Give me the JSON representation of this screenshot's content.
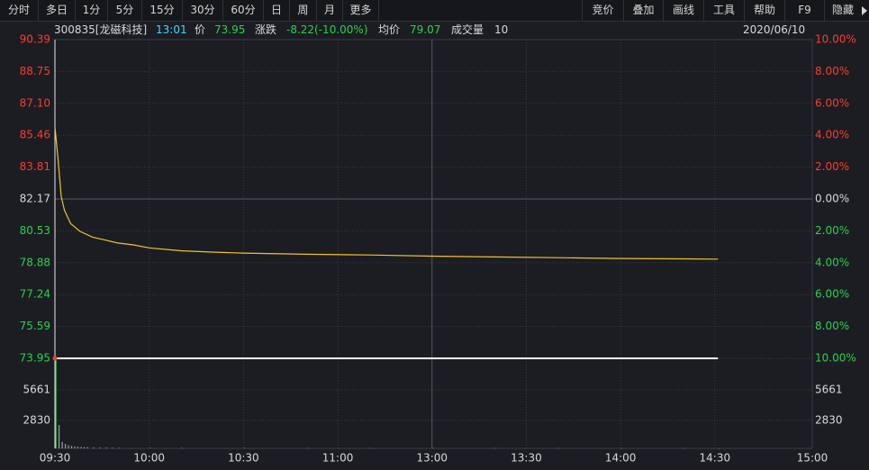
{
  "toolbar": {
    "left_tabs": [
      "分时",
      "多日",
      "1分",
      "5分",
      "15分",
      "30分",
      "60分",
      "日",
      "周",
      "月",
      "更多"
    ],
    "active_tab": "分时",
    "right_tools": [
      "竞价",
      "叠加",
      "画线",
      "工具",
      "帮助",
      "F9",
      "隐藏"
    ]
  },
  "info_bar": {
    "stock": "300835[龙磁科技]",
    "time": "13:01",
    "price_label": "价",
    "price": "73.95",
    "change_label": "涨跌",
    "change": "-8.22(-10.00%)",
    "avg_label": "均价",
    "avg": "79.07",
    "volume_label": "成交量",
    "volume": "10",
    "date": "2020/06/10"
  },
  "colors": {
    "up": "#ff3b30",
    "down": "#2ed04e",
    "neutral": "#d8d8d8",
    "avg_line": "#f0c22e",
    "price_line": "#ffffff",
    "grid": "#3a3d44",
    "grid_bright": "#555963"
  },
  "chart_data": {
    "type": "line",
    "symbol": "300835",
    "prev_close": 82.17,
    "price_axis_left": [
      "90.39",
      "88.75",
      "87.10",
      "85.46",
      "83.81",
      "82.17",
      "80.53",
      "78.88",
      "77.24",
      "75.59",
      "73.95"
    ],
    "percent_axis_right": [
      "10.00%",
      "8.00%",
      "6.00%",
      "4.00%",
      "2.00%",
      "0.00%",
      "2.00%",
      "4.00%",
      "6.00%",
      "8.00%",
      "10.00%"
    ],
    "ylim": [
      73.95,
      90.39
    ],
    "volume_axis": [
      "5661",
      "2830"
    ],
    "volume_max": 8491,
    "x_ticks": [
      "09:30",
      "10:00",
      "10:30",
      "11:00",
      "13:00",
      "13:30",
      "14:00",
      "14:30",
      "15:00"
    ],
    "series": [
      {
        "name": "price",
        "minutes": [
          0,
          1,
          211
        ],
        "values": [
          73.95,
          73.95,
          73.95
        ]
      },
      {
        "name": "avg",
        "minutes": [
          0,
          1,
          2,
          3,
          5,
          8,
          12,
          16,
          20,
          25,
          30,
          40,
          50,
          60,
          80,
          100,
          120,
          140,
          160,
          180,
          200,
          211
        ],
        "values": [
          85.9,
          84.2,
          82.3,
          81.6,
          80.9,
          80.5,
          80.2,
          80.05,
          79.9,
          79.8,
          79.65,
          79.5,
          79.43,
          79.38,
          79.32,
          79.28,
          79.22,
          79.18,
          79.14,
          79.1,
          79.08,
          79.07
        ]
      }
    ],
    "volume": {
      "minutes": [
        0,
        1,
        2,
        3,
        4,
        5,
        6,
        7,
        8,
        9,
        10,
        12,
        14,
        16,
        18,
        20,
        30,
        40,
        60,
        80,
        100,
        120,
        140,
        160,
        180,
        200,
        211
      ],
      "values": [
        8400,
        2200,
        600,
        420,
        300,
        240,
        190,
        160,
        140,
        120,
        110,
        90,
        80,
        70,
        65,
        60,
        55,
        50,
        45,
        40,
        40,
        35,
        35,
        30,
        30,
        25,
        10
      ]
    }
  }
}
